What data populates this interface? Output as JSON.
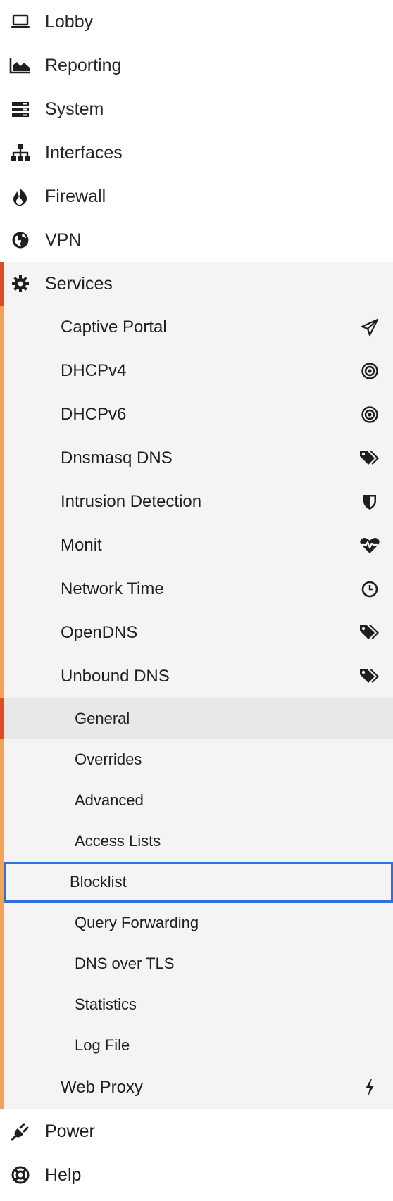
{
  "menu": {
    "top": [
      {
        "label": "Lobby",
        "icon": "laptop-icon"
      },
      {
        "label": "Reporting",
        "icon": "area-chart-icon"
      },
      {
        "label": "System",
        "icon": "server-icon"
      },
      {
        "label": "Interfaces",
        "icon": "sitemap-icon"
      },
      {
        "label": "Firewall",
        "icon": "fire-icon"
      },
      {
        "label": "VPN",
        "icon": "globe-icon"
      }
    ],
    "services": {
      "label": "Services",
      "icon": "gear-icon",
      "items": [
        {
          "label": "Captive Portal",
          "icon": "paper-plane-icon"
        },
        {
          "label": "DHCPv4",
          "icon": "bullseye-icon"
        },
        {
          "label": "DHCPv6",
          "icon": "bullseye-icon"
        },
        {
          "label": "Dnsmasq DNS",
          "icon": "tags-icon"
        },
        {
          "label": "Intrusion Detection",
          "icon": "shield-icon"
        },
        {
          "label": "Monit",
          "icon": "heartbeat-icon"
        },
        {
          "label": "Network Time",
          "icon": "clock-icon"
        },
        {
          "label": "OpenDNS",
          "icon": "tags-icon"
        },
        {
          "label": "Unbound DNS",
          "icon": "tags-icon"
        }
      ],
      "unbound_subitems": [
        {
          "label": "General",
          "active": true
        },
        {
          "label": "Overrides"
        },
        {
          "label": "Advanced"
        },
        {
          "label": "Access Lists"
        },
        {
          "label": "Blocklist",
          "highlighted": true
        },
        {
          "label": "Query Forwarding"
        },
        {
          "label": "DNS over TLS"
        },
        {
          "label": "Statistics"
        },
        {
          "label": "Log File"
        }
      ],
      "after_items": [
        {
          "label": "Web Proxy",
          "icon": "bolt-icon"
        }
      ]
    },
    "bottom": [
      {
        "label": "Power",
        "icon": "plug-icon"
      },
      {
        "label": "Help",
        "icon": "lifebuoy-icon"
      }
    ]
  },
  "colors": {
    "active_accent": "#d94e26",
    "section_accent": "#f0a35d",
    "highlight_border": "#2f6fe0",
    "section_background": "#f4f4f4",
    "active_background": "#e8e8e8"
  }
}
